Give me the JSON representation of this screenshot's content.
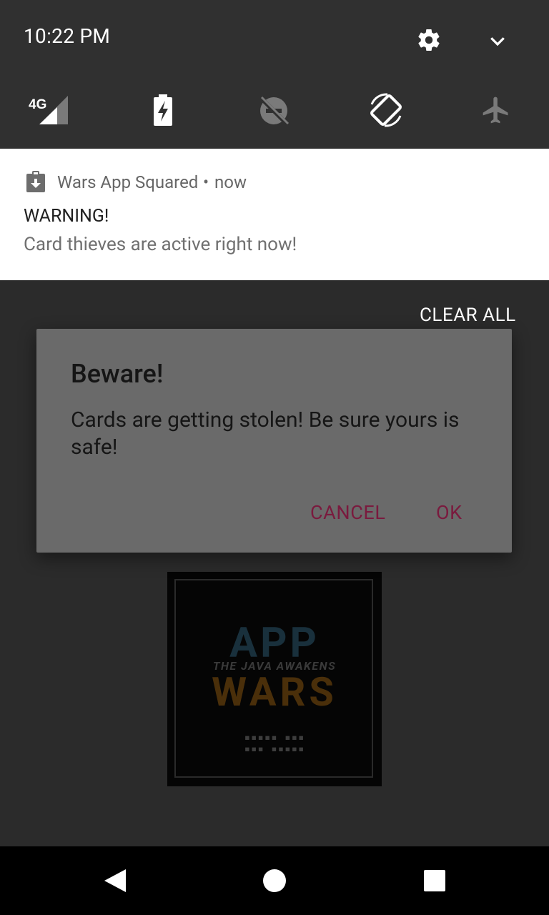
{
  "status": {
    "time": "10:22 PM",
    "network_label": "4G",
    "icons": [
      "gear-icon",
      "chevron-down-icon",
      "signal-4g-icon",
      "battery-charging-icon",
      "do-not-disturb-off-icon",
      "auto-rotate-icon",
      "airplane-mode-icon"
    ]
  },
  "notification": {
    "app_name": "Wars App Squared",
    "separator": "•",
    "time": "now",
    "title": "WARNING!",
    "text": "Card thieves are active right now!"
  },
  "shade_actions": {
    "clear_all": "CLEAR ALL"
  },
  "dialog": {
    "title": "Beware!",
    "message": "Cards are getting stolen! Be sure yours is safe!",
    "cancel": "CANCEL",
    "ok": "OK",
    "accent_color": "#7a1a3e"
  },
  "poster": {
    "line1": "APP",
    "line2": "THE JAVA AWAKENS",
    "line3": "WARS"
  },
  "navbar": {
    "icons": [
      "back-icon",
      "home-icon",
      "recents-icon"
    ]
  }
}
